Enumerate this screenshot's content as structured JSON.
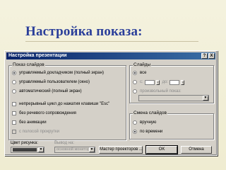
{
  "slide": {
    "title": "Настройка показа:"
  },
  "dialog": {
    "title": "Настройка презентации",
    "help_button": "?",
    "close_button": "X",
    "show_group": {
      "label": "Показ слайдов",
      "options": [
        "управляемый докладчиком (полный экран)",
        "управляемый пользователем (окно)",
        "автоматический (полный экран)"
      ],
      "checkboxes": [
        "непрерывный цикл до нажатия клавиши \"Esc\"",
        "без речевого сопровождения",
        "без анимации",
        "с полосой прокрутки"
      ]
    },
    "slides_group": {
      "label": "Слайды",
      "all": "все",
      "from": "с:",
      "to": "до:",
      "custom": "произвольный показ:"
    },
    "advance_group": {
      "label": "Смена слайдов",
      "manual": "вручную",
      "timings": "по времени"
    },
    "pen_color_label": "Цвет рисунка:",
    "show_on_label": "Вывод на:",
    "show_on_value": "основной монитор",
    "projector_wizard_button": "Мастер проекторов ...",
    "ok_button": "OK",
    "cancel_button": "Отмена"
  }
}
